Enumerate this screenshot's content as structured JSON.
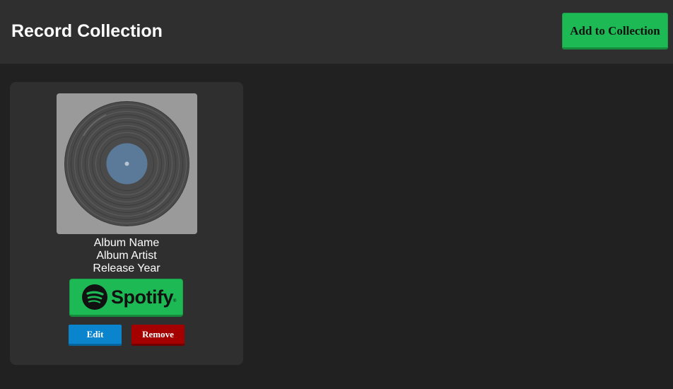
{
  "header": {
    "title": "Record Collection",
    "add_button_label": "Add to Collection"
  },
  "records": [
    {
      "name": "Album Name",
      "artist": "Album Artist",
      "year": "Release Year",
      "cover_icon": "vinyl-record-icon",
      "spotify": {
        "label": "Spotify",
        "trademark": "®",
        "icon": "spotify-logo-icon"
      },
      "edit_label": "Edit",
      "remove_label": "Remove"
    }
  ],
  "colors": {
    "page_background": "#212121",
    "header_background": "#2f2f2f",
    "card_background": "#2f2f2f",
    "spotify_green": "#1db954",
    "edit_blue": "#0a84cc",
    "remove_red": "#a50000",
    "cover_background": "#9a9a9a",
    "vinyl_label": "#5b7a9a"
  }
}
